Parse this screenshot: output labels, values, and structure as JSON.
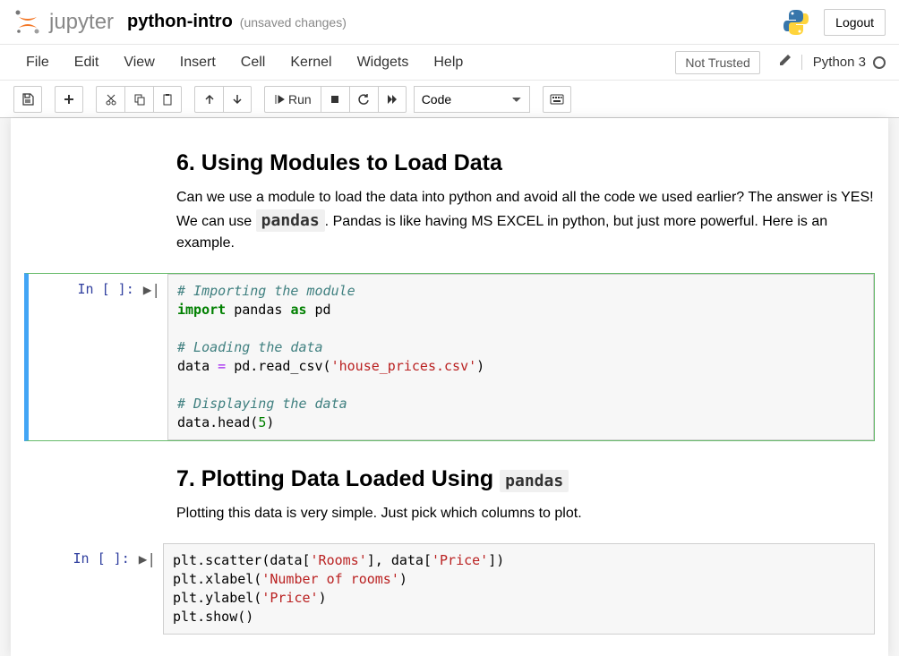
{
  "header": {
    "logo_text": "jupyter",
    "notebook_name": "python-intro",
    "save_status": "(unsaved changes)",
    "logout": "Logout"
  },
  "menubar": {
    "items": [
      "File",
      "Edit",
      "View",
      "Insert",
      "Cell",
      "Kernel",
      "Widgets",
      "Help"
    ],
    "trust": "Not Trusted",
    "kernel": "Python 3"
  },
  "toolbar": {
    "run_label": "Run",
    "cell_type": "Code"
  },
  "cells": {
    "md1": {
      "heading": "6. Using Modules to Load Data",
      "p1_a": "Can we use a module to load the data into python and avoid all the code we used earlier? The answer is YES! We can use ",
      "p1_code": "pandas",
      "p1_b": ". Pandas is like having MS EXCEL in python, but just more powerful. Here is an example."
    },
    "code1": {
      "prompt": "In [ ]:",
      "c1": "# Importing the module",
      "kw_import": "import",
      "t1": " pandas ",
      "kw_as": "as",
      "t2": " pd",
      "c2": "# Loading the data",
      "t3": "data ",
      "op_eq": "=",
      "t4": " pd.read_csv(",
      "s1": "'house_prices.csv'",
      "t5": ")",
      "c3": "# Displaying the data",
      "t6": "data.head(",
      "n1": "5",
      "t7": ")"
    },
    "md2": {
      "heading_a": "7. Plotting Data Loaded Using ",
      "heading_code": "pandas",
      "p1": "Plotting this data is very simple. Just pick which columns to plot."
    },
    "code2": {
      "prompt": "In [ ]:",
      "t1": "plt.scatter(data[",
      "s1": "'Rooms'",
      "t2": "], data[",
      "s2": "'Price'",
      "t3": "])",
      "t4": "plt.xlabel(",
      "s3": "'Number of rooms'",
      "t5": ")",
      "t6": "plt.ylabel(",
      "s4": "'Price'",
      "t7": ")",
      "t8": "plt.show()"
    }
  }
}
